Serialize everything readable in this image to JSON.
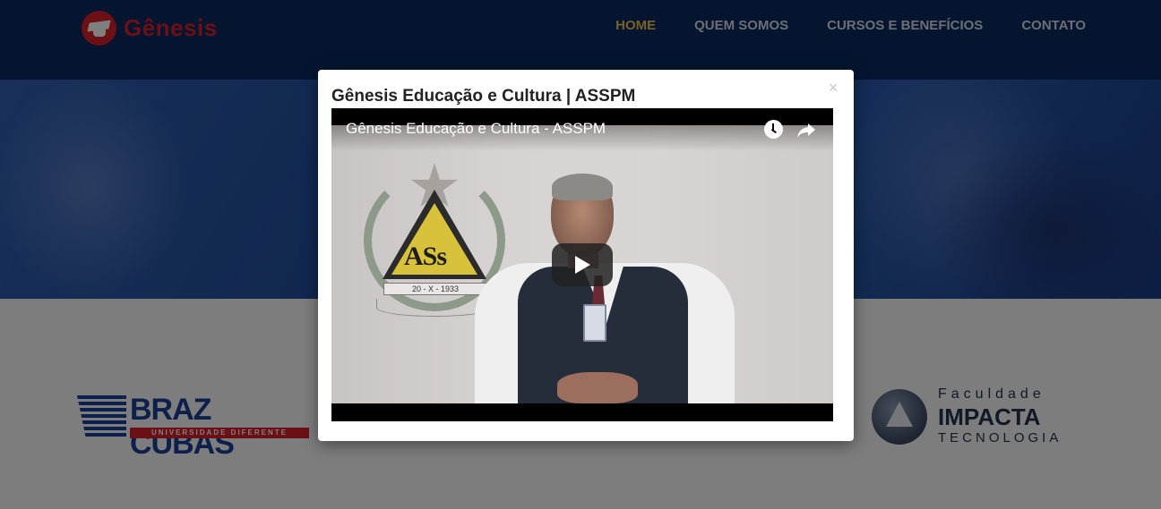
{
  "site": {
    "logo_text": "Gênesis"
  },
  "nav": {
    "items": [
      {
        "label": "HOME",
        "active": true
      },
      {
        "label": "QUEM SOMOS"
      },
      {
        "label": "CURSOS E BENEFÍCIOS"
      },
      {
        "label": "CONTATO"
      }
    ]
  },
  "partners": {
    "braz_cubas": {
      "name": "BRAZ CUBAS",
      "tagline": "UNIVERSIDADE DIFERENTE"
    },
    "impacta": {
      "line1": "Faculdade",
      "line2": "IMPACTA",
      "line3": "TECNOLOGIA"
    }
  },
  "modal": {
    "title": "Gênesis Educação e Cultura | ASSPM",
    "close_label": "×",
    "video": {
      "title": "Gênesis Educação e Cultura - ASSPM",
      "emblem_text": "ASs",
      "emblem_date": "20 - X - 1933"
    }
  },
  "colors": {
    "header_bg": "#0a2a5e",
    "brand_red": "#d6202b",
    "nav_active": "#f1c34a",
    "nav_text": "#d9dde6"
  }
}
